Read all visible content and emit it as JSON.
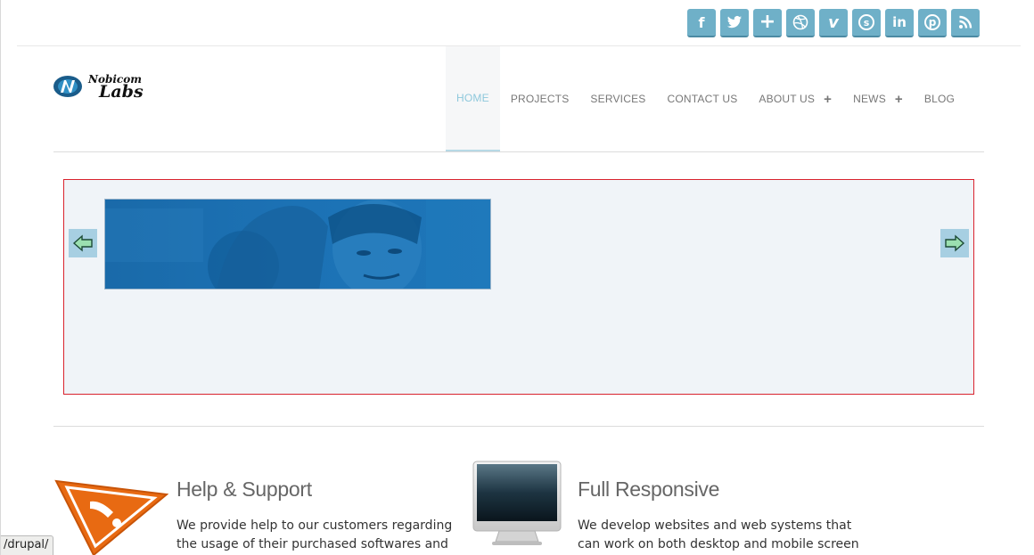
{
  "social": {
    "items": [
      {
        "name": "facebook",
        "glyph": "f"
      },
      {
        "name": "twitter",
        "glyph": ""
      },
      {
        "name": "google-plus",
        "glyph": "+"
      },
      {
        "name": "dribbble",
        "glyph": ""
      },
      {
        "name": "vimeo",
        "glyph": "v"
      },
      {
        "name": "skype",
        "glyph": "s"
      },
      {
        "name": "linkedin",
        "glyph": "in"
      },
      {
        "name": "pinterest",
        "glyph": "p"
      },
      {
        "name": "rss",
        "glyph": ""
      }
    ],
    "button_color": "#6fb0c8"
  },
  "logo": {
    "top_text": "Nobicom",
    "bottom_text": "Labs"
  },
  "nav": {
    "items": [
      {
        "label": "HOME",
        "active": true
      },
      {
        "label": "PROJECTS"
      },
      {
        "label": "SERVICES"
      },
      {
        "label": "CONTACT US"
      },
      {
        "label": "ABOUT US",
        "plus": "+"
      },
      {
        "label": "NEWS",
        "plus": "+"
      },
      {
        "label": "BLOG"
      }
    ],
    "active_color": "#8ec8dc"
  },
  "slider": {
    "border_color": "#d9232e",
    "prev_icon": "arrow-left-icon",
    "next_icon": "arrow-right-icon"
  },
  "features": [
    {
      "title": "Help & Support",
      "text": "We provide help to our customers regarding the usage of their purchased softwares and",
      "icon": "warning-triangle-icon"
    },
    {
      "title": "Full Responsive",
      "text": "We develop websites and web systems that can work on both desktop and mobile screen",
      "icon": "monitor-icon"
    }
  ],
  "status_bar": {
    "text": "/drupal/"
  }
}
